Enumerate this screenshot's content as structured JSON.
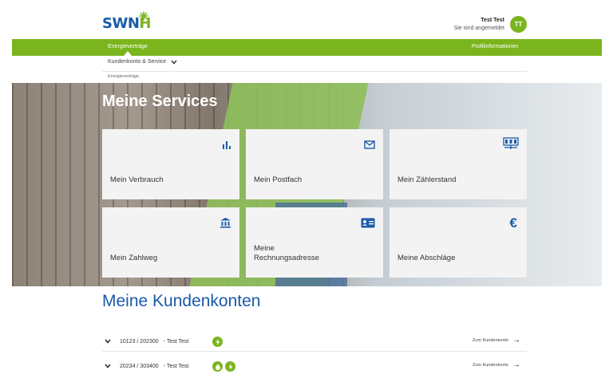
{
  "header": {
    "logo_main": "SWN",
    "logo_accent": "H",
    "user_name": "Test Test",
    "user_status": "Sie sind angemeldet",
    "avatar_initials": "TT"
  },
  "nav": {
    "left": "Energieverträge",
    "right": "Profilinformationen"
  },
  "subnav": {
    "dropdown_label": "Kundenkonto & Service",
    "breadcrumb": "Energieverträge"
  },
  "hero": {
    "title": "Meine Services"
  },
  "tiles": [
    {
      "label": "Mein Verbrauch",
      "icon": "bar-chart-icon"
    },
    {
      "label": "Mein Postfach",
      "icon": "mail-icon"
    },
    {
      "label": "Mein Zählerstand",
      "icon": "meter-icon"
    },
    {
      "label": "Mein Zahlweg",
      "icon": "bank-icon"
    },
    {
      "label": "Meine Rechnungsadresse",
      "icon": "id-card-icon"
    },
    {
      "label": "Meine Abschläge",
      "icon": "euro-icon"
    }
  ],
  "accounts": {
    "title": "Meine Kundenkonten",
    "rows": [
      {
        "number": "10123 / 202300",
        "name": "- Test Test",
        "badges": [
          "electricity-icon"
        ],
        "link": "Zum Kundenkonto"
      },
      {
        "number": "20234 / 303400",
        "name": "- Test Test",
        "badges": [
          "gas-icon",
          "electricity-icon"
        ],
        "link": "Zum Kundenkonto"
      }
    ]
  },
  "colors": {
    "green": "#7ab51d",
    "blue": "#1a5aa8"
  }
}
